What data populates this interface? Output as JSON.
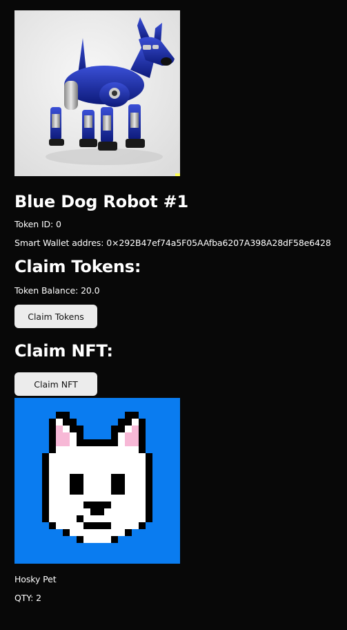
{
  "nft": {
    "image_icon": "blue-robot-dog-image",
    "title": "Blue Dog Robot #1",
    "token_id_text": "Token ID: 0",
    "wallet_text": "Smart Wallet addres: 0×292B47ef74a5F05AAfba6207A398A28dF58e6428"
  },
  "claim_tokens": {
    "heading": "Claim Tokens:",
    "balance_text": "Token Balance: 20.0",
    "button_label": "Claim Tokens"
  },
  "claim_nft": {
    "heading": "Claim NFT:",
    "button_label": "Claim NFT",
    "pet_image_icon": "pixel-white-dog-image",
    "pet_name": "Hosky Pet",
    "qty_text": "QTY: 2"
  },
  "colors": {
    "background": "#080808",
    "text": "#ffffff",
    "button_bg": "#ececec",
    "pet_bg": "#0a7cf0"
  }
}
